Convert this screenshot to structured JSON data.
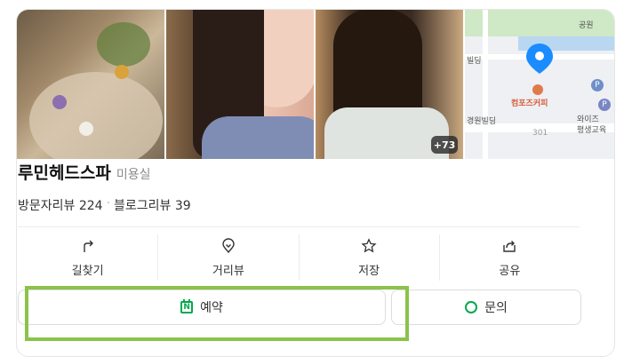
{
  "photos": {
    "items": [
      {
        "name": "spa-tray-photo"
      },
      {
        "name": "long-hair-photo"
      },
      {
        "name": "bob-hair-photo"
      },
      {
        "name": "map-thumbnail"
      }
    ],
    "more_count": "+73",
    "map_labels": {
      "park": "공원",
      "cafe": "컴포즈커피",
      "building_left_top": "빌딩",
      "building_left": "경원빌딩",
      "right_top": "와이즈",
      "right_bottom": "평생교육",
      "number": "301"
    }
  },
  "place": {
    "name": "루민헤드스파",
    "category": "미용실",
    "visitor_reviews": "방문자리뷰 224",
    "separator": "·",
    "blog_reviews": "블로그리뷰 39"
  },
  "actions": [
    {
      "label": "길찾기",
      "icon": "directions-icon"
    },
    {
      "label": "거리뷰",
      "icon": "street-view-icon"
    },
    {
      "label": "저장",
      "icon": "star-icon"
    },
    {
      "label": "공유",
      "icon": "share-icon"
    }
  ],
  "buttons": {
    "reserve_label": "예약",
    "inquiry_label": "문의"
  },
  "colors": {
    "naver_green": "#03a94d",
    "highlight_green": "#8bc34a",
    "map_pin_blue": "#1a8cff"
  }
}
